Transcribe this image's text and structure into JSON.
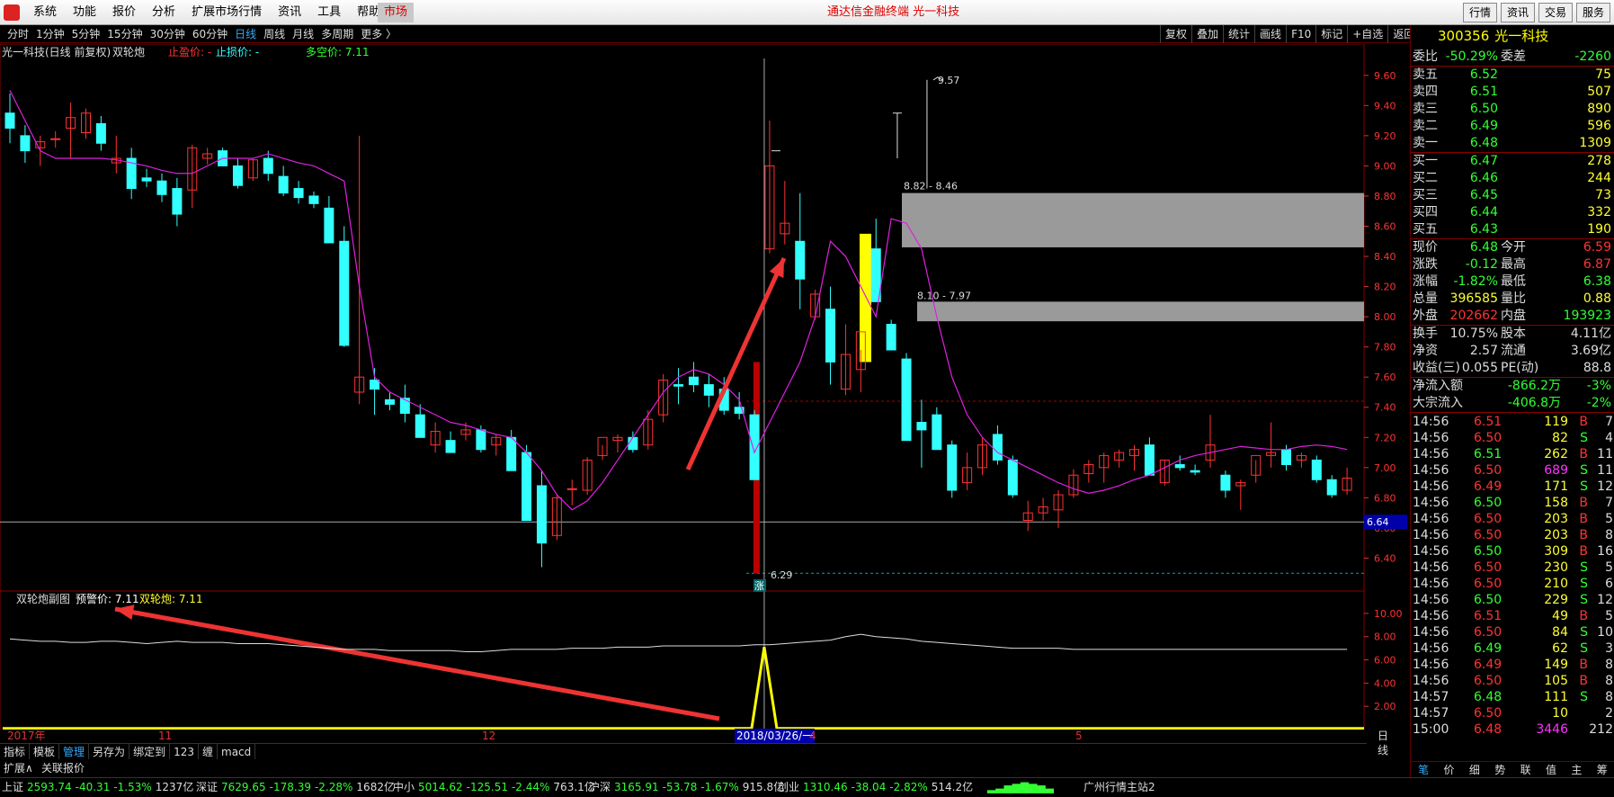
{
  "titlebar": {
    "menu": [
      "系统",
      "功能",
      "报价",
      "分析",
      "扩展市场行情",
      "资讯",
      "工具",
      "帮助"
    ],
    "market": "市场",
    "title": "通达信金融终端  光一科技",
    "right_buttons": [
      "行情",
      "资讯",
      "交易",
      "服务"
    ]
  },
  "toolbar": {
    "periods": [
      "分时",
      "1分钟",
      "5分钟",
      "15分钟",
      "30分钟",
      "60分钟",
      "日线",
      "周线",
      "月线",
      "多周期",
      "更多 〉"
    ],
    "active_period": "日线",
    "tools": [
      "复权",
      "叠加",
      "统计",
      "画线",
      "F10",
      "标记",
      "+自选",
      "返回"
    ]
  },
  "infoline": {
    "name": "光一科技(日线 前复权)",
    "indicator": "双轮炮",
    "stop_profit": "止盈价: -",
    "stop_loss": "止损价: -",
    "long_short": "多空价: 7.11"
  },
  "chart_annotations": {
    "high_label": "9.57",
    "zone1_label": "8.82 - 8.46",
    "zone2_label": "8.10 - 7.97",
    "low_label": "6.29",
    "current_price_tag": "6.64",
    "marker": "涨"
  },
  "subinfo": {
    "name": "双轮炮副图",
    "warn": "预警价: 7.11",
    "gun": "双轮炮: 7.11"
  },
  "date_axis": [
    "2017年",
    "11",
    "12",
    "2018/03/26/一",
    "4",
    "5"
  ],
  "bottom_tabs": [
    "指标",
    "模板",
    "管理",
    "另存为",
    "绑定到",
    "123",
    "缠",
    "macd"
  ],
  "active_bottom_tab": "管理",
  "scale_label": "日线",
  "expand": [
    "扩展∧",
    "关联报价"
  ],
  "statusbar": [
    {
      "name": "上证",
      "value": "2593.74",
      "change": "-40.31",
      "pct": "-1.53%",
      "vol": "1237亿"
    },
    {
      "name": "深证",
      "value": "7629.65",
      "change": "-178.39",
      "pct": "-2.28%",
      "vol": "1682亿"
    },
    {
      "name": "中小",
      "value": "5014.62",
      "change": "-125.51",
      "pct": "-2.44%",
      "vol": "763.1亿"
    },
    {
      "name": "沪深",
      "value": "3165.91",
      "change": "-53.78",
      "pct": "-1.67%",
      "vol": "915.8亿"
    },
    {
      "name": "创业",
      "value": "1310.46",
      "change": "-38.04",
      "pct": "-2.82%",
      "vol": "514.2亿"
    }
  ],
  "server": "广州行情主站2",
  "price_axis": [
    "9.60",
    "9.40",
    "9.20",
    "9.00",
    "8.80",
    "8.60",
    "8.40",
    "8.20",
    "8.00",
    "7.80",
    "7.60",
    "7.40",
    "7.20",
    "7.00",
    "6.80",
    "6.60",
    "6.40"
  ],
  "sub_axis": [
    "10.00",
    "8.00",
    "6.00",
    "4.00",
    "2.00"
  ],
  "panel": {
    "code": "300356",
    "name": "光一科技",
    "weibi_label": "委比",
    "weibi": "-50.29%",
    "weicha_label": "委差",
    "weicha": "-2260",
    "asks": [
      {
        "label": "卖五",
        "price": "6.52",
        "vol": "75"
      },
      {
        "label": "卖四",
        "price": "6.51",
        "vol": "507"
      },
      {
        "label": "卖三",
        "price": "6.50",
        "vol": "890"
      },
      {
        "label": "卖二",
        "price": "6.49",
        "vol": "596"
      },
      {
        "label": "卖一",
        "price": "6.48",
        "vol": "1309"
      }
    ],
    "bids": [
      {
        "label": "买一",
        "price": "6.47",
        "vol": "278"
      },
      {
        "label": "买二",
        "price": "6.46",
        "vol": "244"
      },
      {
        "label": "买三",
        "price": "6.45",
        "vol": "73"
      },
      {
        "label": "买四",
        "price": "6.44",
        "vol": "332"
      },
      {
        "label": "买五",
        "price": "6.43",
        "vol": "190"
      }
    ],
    "stats": [
      {
        "l1": "现价",
        "v1": "6.48",
        "l2": "今开",
        "v2": "6.59"
      },
      {
        "l1": "涨跌",
        "v1": "-0.12",
        "l2": "最高",
        "v2": "6.87"
      },
      {
        "l1": "涨幅",
        "v1": "-1.82%",
        "l2": "最低",
        "v2": "6.38"
      },
      {
        "l1": "总量",
        "v1": "396585",
        "l2": "量比",
        "v2": "0.88"
      },
      {
        "l1": "外盘",
        "v1": "202662",
        "l2": "内盘",
        "v2": "193923"
      }
    ],
    "stats2": [
      {
        "l1": "换手",
        "v1": "10.75%",
        "l2": "股本",
        "v2": "4.11亿"
      },
      {
        "l1": "净资",
        "v1": "2.57",
        "l2": "流通",
        "v2": "3.69亿"
      },
      {
        "l1": "收益(三)",
        "v1": "0.055",
        "l2": "PE(动)",
        "v2": "88.8"
      }
    ],
    "flows": [
      {
        "label": "净流入额",
        "value": "-866.2万",
        "pct": "-3%"
      },
      {
        "label": "大宗流入",
        "value": "-406.8万",
        "pct": "-2%"
      }
    ],
    "ticks": [
      {
        "t": "14:56",
        "p": "6.51",
        "v": "119",
        "d": "B",
        "n": "7"
      },
      {
        "t": "14:56",
        "p": "6.50",
        "v": "82",
        "d": "S",
        "n": "4"
      },
      {
        "t": "14:56",
        "p": "6.51",
        "v": "262",
        "d": "B",
        "n": "11"
      },
      {
        "t": "14:56",
        "p": "6.50",
        "v": "689",
        "d": "S",
        "n": "11"
      },
      {
        "t": "14:56",
        "p": "6.49",
        "v": "171",
        "d": "S",
        "n": "12"
      },
      {
        "t": "14:56",
        "p": "6.50",
        "v": "158",
        "d": "B",
        "n": "7"
      },
      {
        "t": "14:56",
        "p": "6.50",
        "v": "203",
        "d": "B",
        "n": "5"
      },
      {
        "t": "14:56",
        "p": "6.50",
        "v": "203",
        "d": "B",
        "n": "8"
      },
      {
        "t": "14:56",
        "p": "6.50",
        "v": "309",
        "d": "B",
        "n": "16"
      },
      {
        "t": "14:56",
        "p": "6.50",
        "v": "230",
        "d": "S",
        "n": "5"
      },
      {
        "t": "14:56",
        "p": "6.50",
        "v": "210",
        "d": "S",
        "n": "6"
      },
      {
        "t": "14:56",
        "p": "6.50",
        "v": "229",
        "d": "S",
        "n": "12"
      },
      {
        "t": "14:56",
        "p": "6.51",
        "v": "49",
        "d": "B",
        "n": "5"
      },
      {
        "t": "14:56",
        "p": "6.50",
        "v": "84",
        "d": "S",
        "n": "10"
      },
      {
        "t": "14:56",
        "p": "6.49",
        "v": "62",
        "d": "S",
        "n": "3"
      },
      {
        "t": "14:56",
        "p": "6.49",
        "v": "149",
        "d": "B",
        "n": "8"
      },
      {
        "t": "14:56",
        "p": "6.50",
        "v": "105",
        "d": "B",
        "n": "8"
      },
      {
        "t": "14:57",
        "p": "6.48",
        "v": "111",
        "d": "S",
        "n": "8"
      },
      {
        "t": "14:57",
        "p": "6.50",
        "v": "10",
        "d": "",
        "n": "2"
      },
      {
        "t": "15:00",
        "p": "6.48",
        "v": "3446",
        "d": "",
        "n": "212"
      }
    ],
    "tabs": [
      "笔",
      "价",
      "细",
      "势",
      "联",
      "值",
      "主",
      "筹"
    ]
  },
  "colors": {
    "up": "#ff3333",
    "down": "#33ffff",
    "ma": "#e020e0",
    "zone": "#9a9a9a",
    "signal": "#ffff00"
  },
  "chart_data": {
    "type": "candlestick",
    "ohlc": [
      [
        9.35,
        9.48,
        9.15,
        9.25
      ],
      [
        9.2,
        9.27,
        9.02,
        9.1
      ],
      [
        9.12,
        9.2,
        9.0,
        9.16
      ],
      [
        9.18,
        9.23,
        9.12,
        9.18
      ],
      [
        9.25,
        9.42,
        9.05,
        9.32
      ],
      [
        9.22,
        9.38,
        9.18,
        9.35
      ],
      [
        9.28,
        9.33,
        9.1,
        9.15
      ],
      [
        9.02,
        9.2,
        8.95,
        9.05
      ],
      [
        9.05,
        9.12,
        8.78,
        8.85
      ],
      [
        8.92,
        8.98,
        8.86,
        8.9
      ],
      [
        8.9,
        8.95,
        8.76,
        8.81
      ],
      [
        8.85,
        8.92,
        8.6,
        8.68
      ],
      [
        8.84,
        9.14,
        8.72,
        9.12
      ],
      [
        9.05,
        9.12,
        9.01,
        9.08
      ],
      [
        9.1,
        9.12,
        9.05,
        9.0
      ],
      [
        9.0,
        9.05,
        8.85,
        8.87
      ],
      [
        8.92,
        9.05,
        8.9,
        9.04
      ],
      [
        9.05,
        9.1,
        8.9,
        8.95
      ],
      [
        8.93,
        9.0,
        8.8,
        8.82
      ],
      [
        8.85,
        8.9,
        8.75,
        8.79
      ],
      [
        8.8,
        8.83,
        8.72,
        8.75
      ],
      [
        8.72,
        8.8,
        8.5,
        8.49
      ],
      [
        8.5,
        8.6,
        7.8,
        7.81
      ],
      [
        7.5,
        9.2,
        7.42,
        7.6
      ],
      [
        7.58,
        7.66,
        7.35,
        7.52
      ],
      [
        7.45,
        7.5,
        7.38,
        7.42
      ],
      [
        7.46,
        7.55,
        7.3,
        7.36
      ],
      [
        7.35,
        7.42,
        7.24,
        7.2
      ],
      [
        7.15,
        7.3,
        7.1,
        7.24
      ],
      [
        7.18,
        7.24,
        7.14,
        7.1
      ],
      [
        7.22,
        7.3,
        7.18,
        7.25
      ],
      [
        7.25,
        7.28,
        7.1,
        7.12
      ],
      [
        7.15,
        7.22,
        7.08,
        7.2
      ],
      [
        7.2,
        7.25,
        7.08,
        6.98
      ],
      [
        7.1,
        7.15,
        6.75,
        6.65
      ],
      [
        6.88,
        6.98,
        6.34,
        6.5
      ],
      [
        6.55,
        6.82,
        6.52,
        6.8
      ],
      [
        6.86,
        6.92,
        6.75,
        6.86
      ],
      [
        6.85,
        7.07,
        6.82,
        7.05
      ],
      [
        7.08,
        7.15,
        7.05,
        7.2
      ],
      [
        7.18,
        7.22,
        7.1,
        7.2
      ],
      [
        7.2,
        7.24,
        7.1,
        7.12
      ],
      [
        7.15,
        7.38,
        7.12,
        7.32
      ],
      [
        7.35,
        7.62,
        7.3,
        7.58
      ],
      [
        7.55,
        7.66,
        7.42,
        7.54
      ],
      [
        7.6,
        7.7,
        7.5,
        7.55
      ],
      [
        7.55,
        7.62,
        7.4,
        7.48
      ],
      [
        7.52,
        7.6,
        7.35,
        7.38
      ],
      [
        7.4,
        7.5,
        7.32,
        7.36
      ],
      [
        7.35,
        7.38,
        6.95,
        6.92
      ],
      [
        8.45,
        9.3,
        8.42,
        9.0
      ],
      [
        8.55,
        8.9,
        8.48,
        8.62
      ],
      [
        8.5,
        8.82,
        8.05,
        8.25
      ],
      [
        8.0,
        8.18,
        7.98,
        8.15
      ],
      [
        8.05,
        8.2,
        7.55,
        7.7
      ],
      [
        7.52,
        7.95,
        7.48,
        7.75
      ],
      [
        7.65,
        7.78,
        7.5,
        7.9
      ],
      [
        8.45,
        8.65,
        8.3,
        8.1
      ],
      [
        7.95,
        7.98,
        7.85,
        7.78
      ],
      [
        7.72,
        7.76,
        7.35,
        7.18
      ],
      [
        7.3,
        7.45,
        7.0,
        7.25
      ],
      [
        7.35,
        7.4,
        7.15,
        7.12
      ],
      [
        7.15,
        7.18,
        6.8,
        6.85
      ],
      [
        6.9,
        7.1,
        6.85,
        7.0
      ],
      [
        7.0,
        7.2,
        6.95,
        7.15
      ],
      [
        7.22,
        7.28,
        7.02,
        7.05
      ],
      [
        7.05,
        7.08,
        6.8,
        6.82
      ],
      [
        6.65,
        6.78,
        6.58,
        6.7
      ],
      [
        6.7,
        6.8,
        6.65,
        6.74
      ],
      [
        6.72,
        6.85,
        6.6,
        6.82
      ],
      [
        6.82,
        6.99,
        6.8,
        6.95
      ],
      [
        6.96,
        7.05,
        6.9,
        7.02
      ],
      [
        7.0,
        7.1,
        6.9,
        7.08
      ],
      [
        7.05,
        7.12,
        7.0,
        7.1
      ],
      [
        7.08,
        7.15,
        6.98,
        7.12
      ],
      [
        7.15,
        7.2,
        6.95,
        6.95
      ],
      [
        6.9,
        7.05,
        6.88,
        7.05
      ],
      [
        7.02,
        7.08,
        6.98,
        7.0
      ],
      [
        6.98,
        7.02,
        6.95,
        6.97
      ],
      [
        7.05,
        7.35,
        7.0,
        7.15
      ],
      [
        6.95,
        6.98,
        6.8,
        6.85
      ],
      [
        6.88,
        6.92,
        6.72,
        6.9
      ],
      [
        6.95,
        7.05,
        6.9,
        7.08
      ],
      [
        7.08,
        7.3,
        7.0,
        7.1
      ],
      [
        7.12,
        7.15,
        6.98,
        7.02
      ],
      [
        7.05,
        7.1,
        7.0,
        7.08
      ],
      [
        7.05,
        7.08,
        6.9,
        6.92
      ],
      [
        6.92,
        6.95,
        6.8,
        6.82
      ],
      [
        6.85,
        7.0,
        6.82,
        6.93
      ]
    ],
    "ma": [
      9.5,
      9.3,
      9.1,
      9.05,
      9.05,
      9.05,
      9.05,
      9.04,
      9.02,
      9.0,
      8.97,
      8.95,
      8.95,
      9.0,
      9.05,
      9.05,
      9.05,
      9.08,
      9.05,
      9.02,
      9.0,
      8.95,
      8.9,
      8.2,
      7.6,
      7.5,
      7.45,
      7.4,
      7.35,
      7.3,
      7.28,
      7.25,
      7.22,
      7.2,
      7.1,
      6.98,
      6.82,
      6.72,
      6.78,
      6.9,
      7.05,
      7.2,
      7.35,
      7.5,
      7.6,
      7.65,
      7.62,
      7.55,
      7.45,
      7.1,
      7.3,
      7.5,
      7.7,
      8.0,
      8.5,
      8.4,
      8.2,
      8.0,
      8.65,
      8.62,
      8.45,
      8.0,
      7.6,
      7.35,
      7.2,
      7.1,
      7.05,
      7.0,
      6.95,
      6.9,
      6.86,
      6.83,
      6.85,
      6.88,
      6.92,
      6.95,
      7.0,
      7.05,
      7.08,
      7.1,
      7.12,
      7.14,
      7.13,
      7.12,
      7.12,
      7.14,
      7.15,
      7.14,
      7.12
    ],
    "ylim": [
      6.2,
      9.7
    ],
    "sub_line": [
      7.8,
      7.7,
      7.6,
      7.6,
      7.5,
      7.5,
      7.6,
      7.6,
      7.5,
      7.4,
      7.5,
      7.6,
      7.5,
      7.5,
      7.5,
      7.4,
      7.4,
      7.4,
      7.3,
      7.2,
      7.1,
      7.0,
      6.9,
      6.9,
      6.9,
      6.8,
      6.8,
      6.8,
      6.8,
      6.8,
      6.7,
      6.7,
      6.8,
      6.9,
      6.9,
      6.9,
      6.9,
      7.0,
      7.0,
      7.0,
      7.1,
      7.1,
      7.1,
      7.2,
      7.2,
      7.2,
      7.2,
      7.2,
      7.2,
      7.3,
      7.3,
      7.4,
      7.5,
      7.6,
      7.7,
      8.0,
      8.2,
      8.0,
      7.9,
      7.8,
      7.6,
      7.5,
      7.4,
      7.3,
      7.2,
      7.1,
      7.0,
      7.0,
      7.0,
      7.0,
      6.9,
      6.9,
      6.9,
      6.9,
      6.9,
      6.9,
      6.9,
      6.9,
      6.9,
      6.9,
      6.9,
      6.9,
      6.9,
      6.9,
      6.9,
      6.9,
      6.9,
      6.9,
      6.9
    ],
    "sub_ylim": [
      0,
      11
    ]
  }
}
